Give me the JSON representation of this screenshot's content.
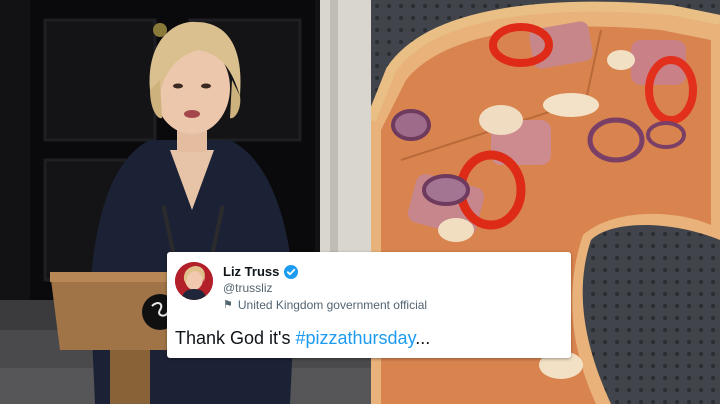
{
  "tweet": {
    "author_name": "Liz Truss",
    "handle": "@trussliz",
    "affiliation": "United Kingdom government official",
    "text_prefix": "Thank God it's ",
    "hashtag": "#pizzathursday",
    "text_suffix": "...",
    "verified_badge_icon": "verified-badge-icon",
    "affiliation_icon": "flag-icon"
  },
  "colors": {
    "hashtag": "#1d9bf0",
    "verified_badge": "#1d9bf0",
    "secondary_text": "#536471",
    "card_background": "#ffffff"
  }
}
